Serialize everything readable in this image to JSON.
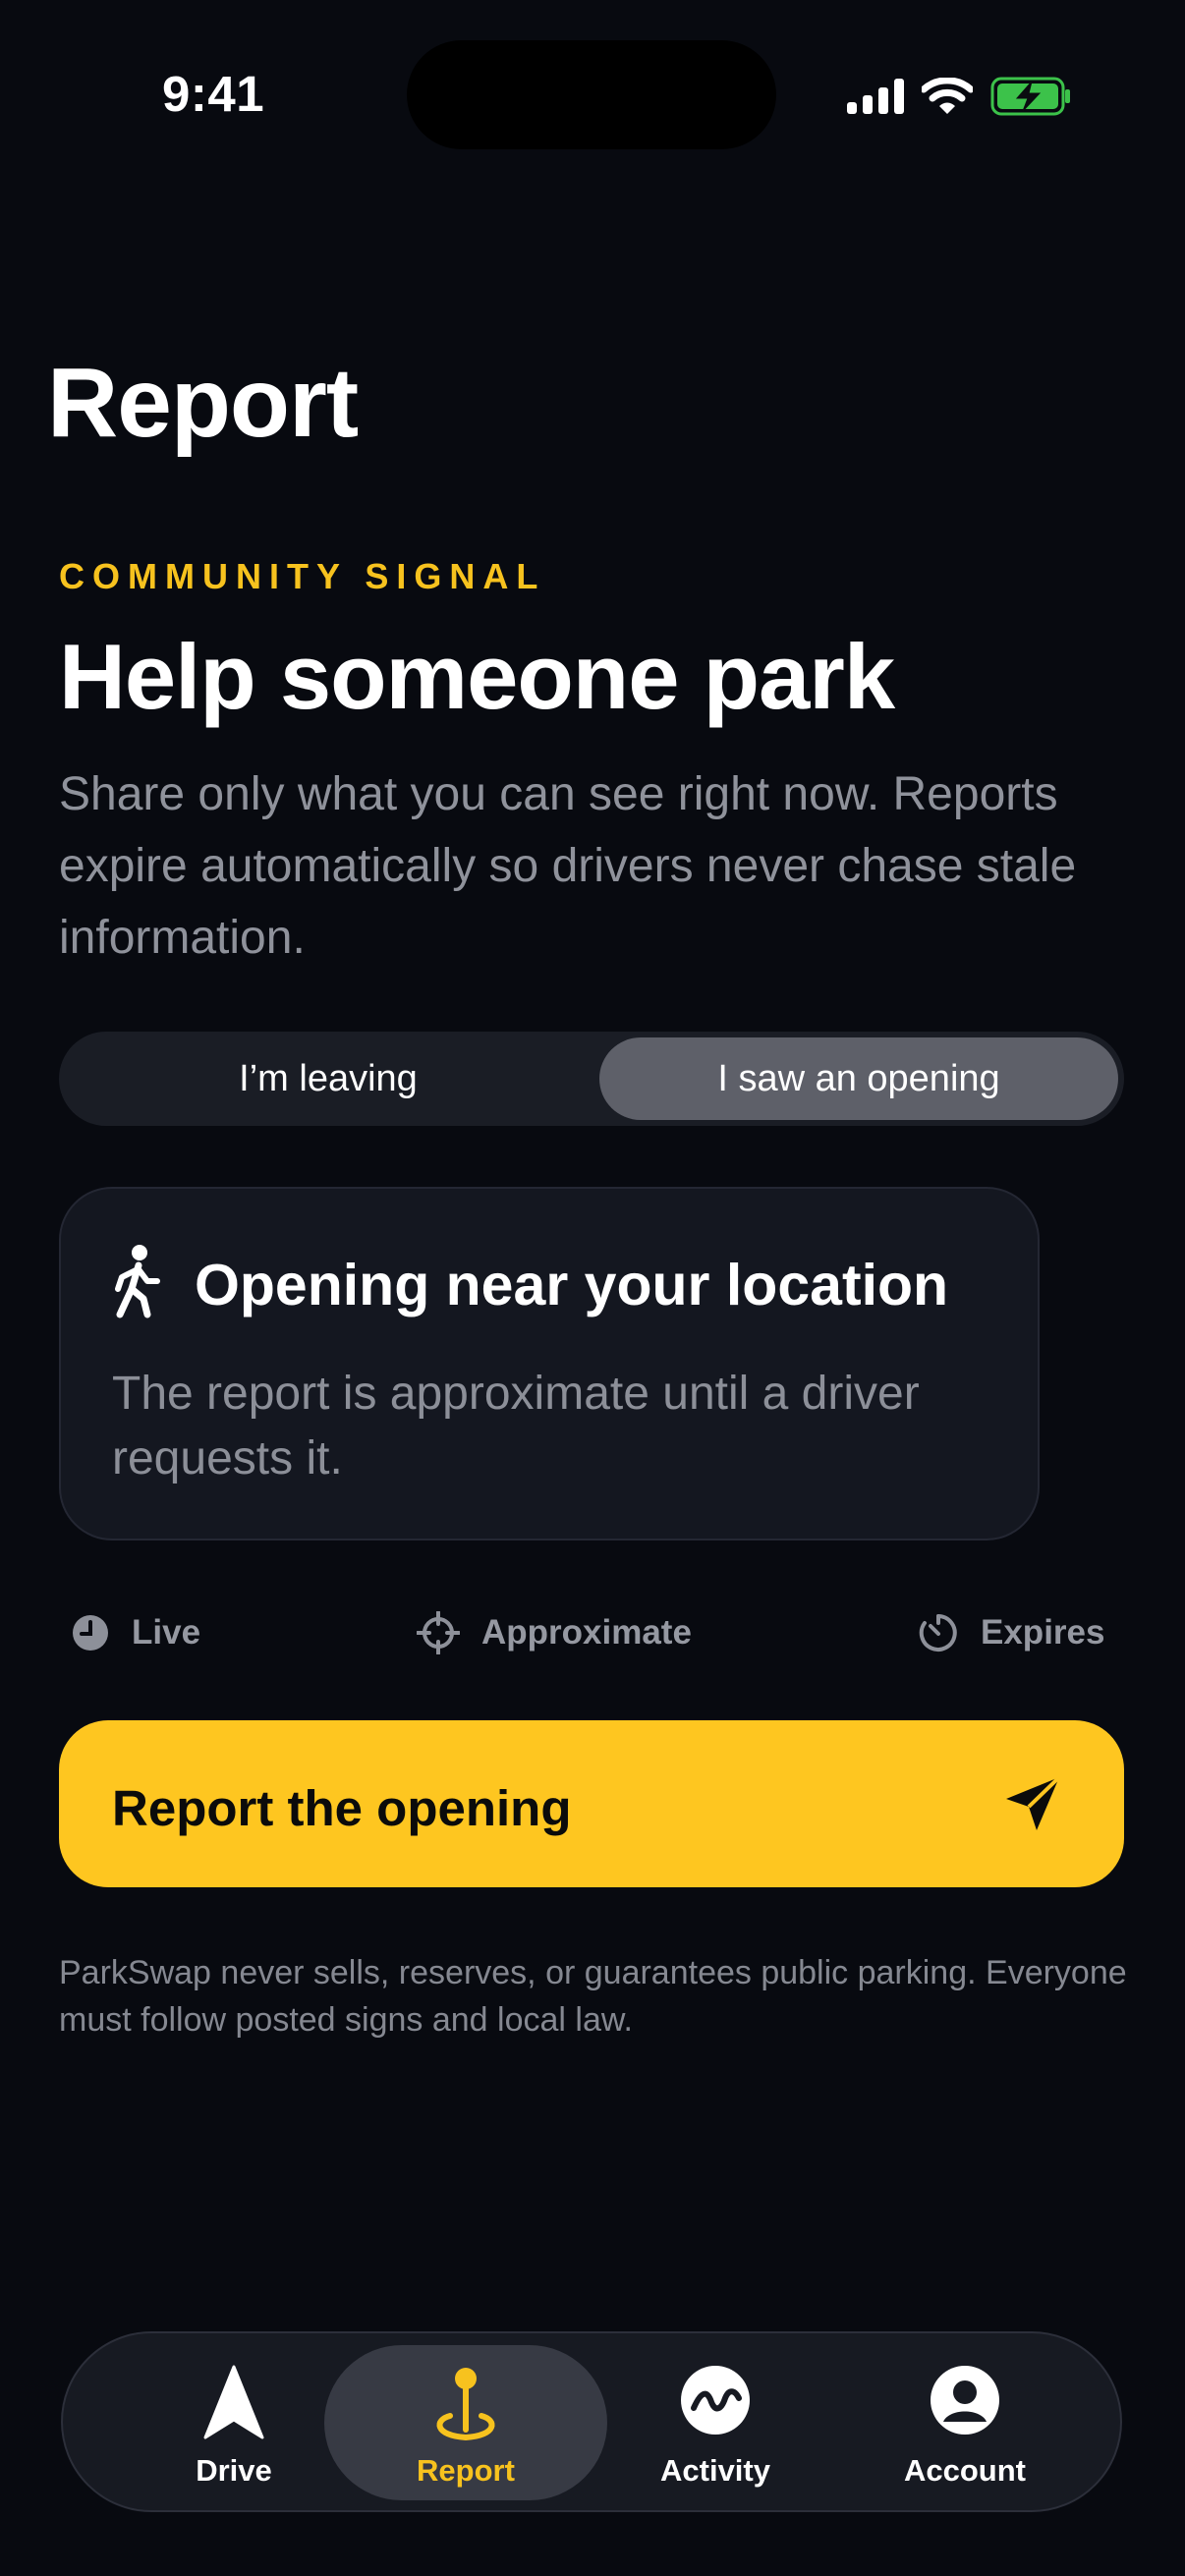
{
  "status_bar": {
    "time": "9:41",
    "battery_color": "#3cc24a"
  },
  "page": {
    "title": "Report"
  },
  "hero": {
    "eyebrow": "COMMUNITY SIGNAL",
    "headline": "Help someone park",
    "description": "Share only what you can see right now. Reports expire automatically so drivers never chase stale information."
  },
  "segmented": {
    "options": [
      "I’m leaving",
      "I saw an opening"
    ],
    "selected": "I saw an opening"
  },
  "info_card": {
    "icon": "walking-person-icon",
    "title": "Opening near your location",
    "body": "The report is approximate until a driver requests it."
  },
  "chips": [
    {
      "icon": "clock-icon",
      "label": "Live"
    },
    {
      "icon": "crosshair-icon",
      "label": "Approximate"
    },
    {
      "icon": "timer-icon",
      "label": "Expires"
    }
  ],
  "cta": {
    "label": "Report the opening",
    "icon": "send-icon"
  },
  "disclaimer": "ParkSwap never sells, reserves, or guarantees public parking. Everyone must follow posted signs and local law.",
  "tabbar": {
    "selected": "Report",
    "items": [
      {
        "label": "Drive",
        "icon": "navigation-arrow-icon"
      },
      {
        "label": "Report",
        "icon": "map-pin-icon"
      },
      {
        "label": "Activity",
        "icon": "activity-icon"
      },
      {
        "label": "Account",
        "icon": "account-icon"
      }
    ]
  },
  "colors": {
    "background": "#080a10",
    "accent": "#fec620",
    "card": "#141720",
    "muted_text": "#8f929b"
  }
}
